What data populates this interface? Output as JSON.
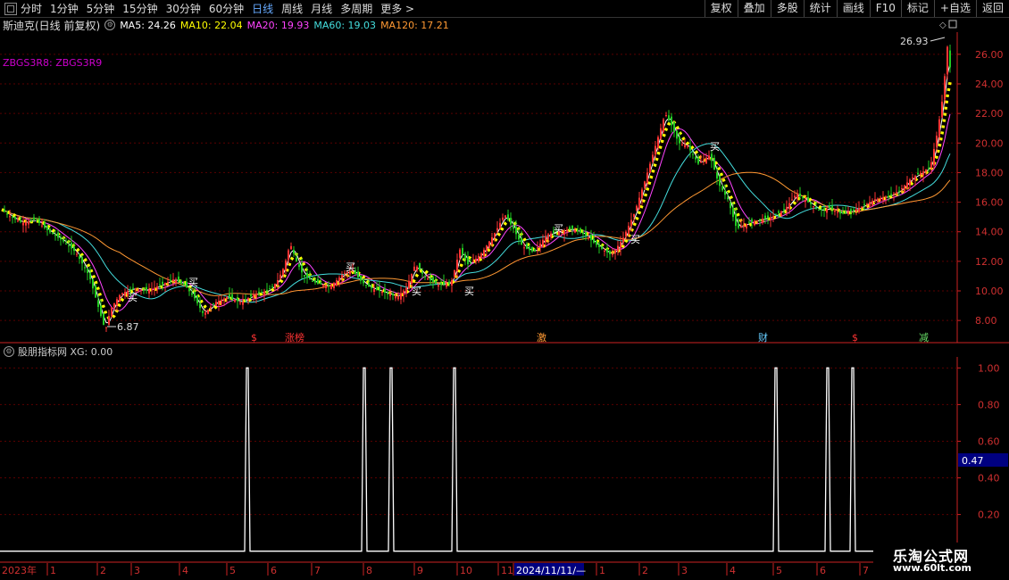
{
  "toolbar": {
    "timeframes": [
      "分时",
      "1分钟",
      "5分钟",
      "15分钟",
      "30分钟",
      "60分钟",
      "日线",
      "周线",
      "月线",
      "多周期",
      "更多 >"
    ],
    "active_timeframe": "日线",
    "buttons": [
      "复权",
      "叠加",
      "多股",
      "统计",
      "画线",
      "F10",
      "标记",
      "+自选",
      "返回"
    ]
  },
  "main_chart": {
    "title": "斯迪克(日线 前复权)",
    "ma_legend": [
      {
        "label": "MA5: 24.26",
        "color": "#ffffff"
      },
      {
        "label": "MA10: 22.04",
        "color": "#ffff00"
      },
      {
        "label": "MA20: 19.93",
        "color": "#ff44ff"
      },
      {
        "label": "MA60: 19.03",
        "color": "#44dddd"
      },
      {
        "label": "MA120: 17.21",
        "color": "#ff9933"
      }
    ],
    "indicator_label": "ZBGS3R8: ZBGS3R9",
    "high_label": "26.93",
    "low_label": "6.87",
    "buy_label": "买",
    "event_labels": [
      "$",
      "涨榜",
      "激",
      "财",
      "$",
      "减"
    ]
  },
  "sub_chart": {
    "title": "股朋指标网 XG: 0.00",
    "value_box": "0.47"
  },
  "x_axis": {
    "labels": [
      "2023年",
      "1",
      "2",
      "3",
      "4",
      "5",
      "6",
      "7",
      "8",
      "9",
      "10",
      "11",
      "2024/11/11/—",
      "1",
      "2",
      "3",
      "4",
      "5",
      "6",
      "7"
    ]
  },
  "watermark": {
    "line1": "乐淘公式网",
    "line2": "www.60lt.com"
  },
  "colors": {
    "up": "#ff3333",
    "down": "#22cc22",
    "axis": "#cc2222",
    "grid": "#6a0000"
  },
  "chart_data": [
    {
      "type": "candlestick",
      "title": "斯迪克(日线 前复权)",
      "y_ticks": [
        8.0,
        10.0,
        12.0,
        14.0,
        16.0,
        18.0,
        20.0,
        22.0,
        24.0,
        26.0
      ],
      "ylim": [
        6.5,
        27.5
      ],
      "grid": true,
      "close_path": [
        [
          0,
          15.6
        ],
        [
          12,
          15.0
        ],
        [
          25,
          14.6
        ],
        [
          40,
          14.8
        ],
        [
          55,
          14.0
        ],
        [
          70,
          13.4
        ],
        [
          85,
          12.6
        ],
        [
          100,
          11.0
        ],
        [
          112,
          8.5
        ],
        [
          118,
          7.3
        ],
        [
          124,
          8.8
        ],
        [
          135,
          9.8
        ],
        [
          150,
          10.2
        ],
        [
          165,
          10.0
        ],
        [
          180,
          10.4
        ],
        [
          195,
          10.8
        ],
        [
          208,
          10.3
        ],
        [
          218,
          9.5
        ],
        [
          228,
          8.4
        ],
        [
          240,
          9.2
        ],
        [
          255,
          9.6
        ],
        [
          270,
          9.2
        ],
        [
          285,
          9.8
        ],
        [
          300,
          10.0
        ],
        [
          310,
          10.6
        ],
        [
          318,
          11.6
        ],
        [
          325,
          13.2
        ],
        [
          332,
          12.0
        ],
        [
          340,
          11.0
        ],
        [
          355,
          10.5
        ],
        [
          370,
          10.3
        ],
        [
          385,
          11.2
        ],
        [
          395,
          11.4
        ],
        [
          405,
          10.6
        ],
        [
          415,
          10.2
        ],
        [
          430,
          9.9
        ],
        [
          445,
          9.6
        ],
        [
          455,
          10.2
        ],
        [
          465,
          11.8
        ],
        [
          475,
          11.0
        ],
        [
          490,
          10.4
        ],
        [
          505,
          10.5
        ],
        [
          515,
          12.8
        ],
        [
          525,
          11.7
        ],
        [
          540,
          12.6
        ],
        [
          555,
          14.0
        ],
        [
          565,
          15.2
        ],
        [
          575,
          14.2
        ],
        [
          585,
          13.0
        ],
        [
          598,
          12.6
        ],
        [
          612,
          13.8
        ],
        [
          625,
          14.0
        ],
        [
          640,
          14.2
        ],
        [
          655,
          13.8
        ],
        [
          670,
          13.0
        ],
        [
          685,
          12.4
        ],
        [
          698,
          13.6
        ],
        [
          710,
          15.2
        ],
        [
          722,
          17.4
        ],
        [
          735,
          20.0
        ],
        [
          745,
          22.0
        ],
        [
          752,
          21.2
        ],
        [
          760,
          20.0
        ],
        [
          770,
          19.8
        ],
        [
          782,
          18.6
        ],
        [
          795,
          19.2
        ],
        [
          805,
          17.2
        ],
        [
          815,
          16.2
        ],
        [
          825,
          14.2
        ],
        [
          838,
          14.6
        ],
        [
          850,
          14.8
        ],
        [
          865,
          15.0
        ],
        [
          880,
          15.6
        ],
        [
          892,
          16.6
        ],
        [
          905,
          16.0
        ],
        [
          918,
          15.4
        ],
        [
          930,
          15.6
        ],
        [
          942,
          15.2
        ],
        [
          955,
          15.4
        ],
        [
          968,
          15.8
        ],
        [
          980,
          16.2
        ],
        [
          995,
          16.4
        ],
        [
          1008,
          16.8
        ],
        [
          1020,
          17.6
        ],
        [
          1032,
          18.0
        ],
        [
          1042,
          18.4
        ],
        [
          1050,
          20.8
        ],
        [
          1056,
          23.2
        ],
        [
          1061,
          26.5
        ],
        [
          1066,
          24.2
        ]
      ],
      "high": 26.93,
      "low": 6.87
    },
    {
      "type": "line",
      "title": "股朋指标网 XG: 0.00",
      "y_ticks": [
        0.2,
        0.4,
        0.6,
        0.8,
        1.0
      ],
      "ylim": [
        -0.06,
        1.06
      ],
      "signals": [
        [
          277,
          1
        ],
        [
          408,
          1
        ],
        [
          438,
          1
        ],
        [
          509,
          1
        ],
        [
          869,
          1
        ],
        [
          927,
          1
        ],
        [
          955,
          1
        ]
      ]
    }
  ]
}
